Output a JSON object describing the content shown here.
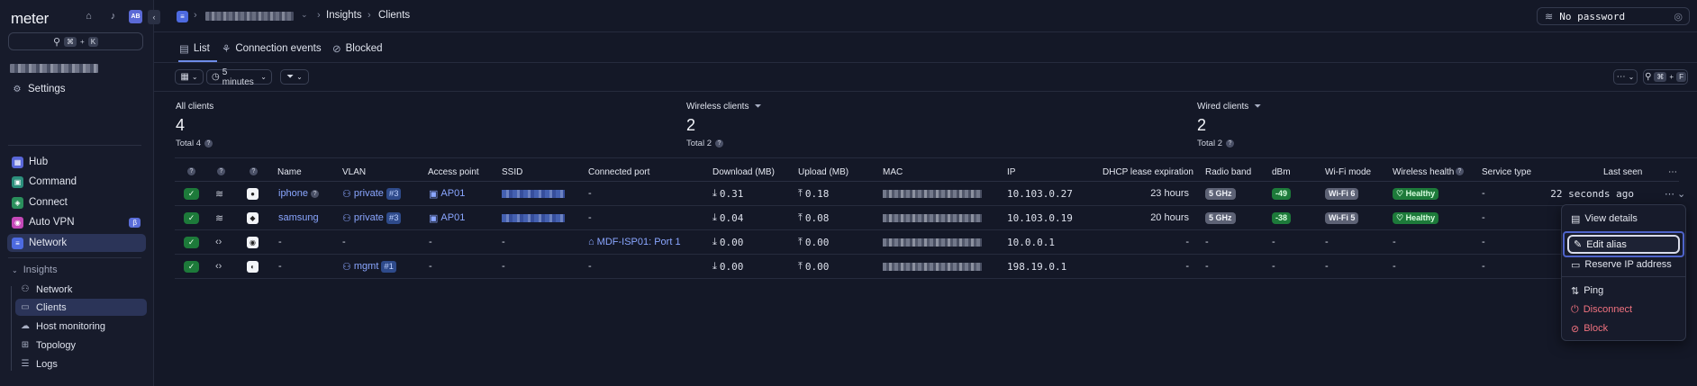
{
  "sidebar": {
    "logo": "meter",
    "avatar_initials": "AB",
    "search_shortcut": [
      "⌘",
      "K"
    ],
    "settings_label": "Settings",
    "items": [
      {
        "label": "Hub",
        "color": "#5967d8"
      },
      {
        "label": "Command",
        "color": "#2c8f7c"
      },
      {
        "label": "Connect",
        "color": "#2a8f5c"
      },
      {
        "label": "Auto VPN",
        "color": "#c448b8",
        "badge": "β"
      },
      {
        "label": "Network",
        "color": "#4d6ae0"
      }
    ],
    "insights_label": "Insights",
    "sub_items": [
      {
        "label": "Network"
      },
      {
        "label": "Clients"
      },
      {
        "label": "Host monitoring"
      },
      {
        "label": "Topology"
      },
      {
        "label": "Logs"
      }
    ]
  },
  "header": {
    "breadcrumbs": [
      "Insights",
      "Clients"
    ],
    "password_label": "No password"
  },
  "tabs": [
    {
      "label": "List"
    },
    {
      "label": "Connection events"
    },
    {
      "label": "Blocked"
    }
  ],
  "toolbar": {
    "time_range": "5 minutes",
    "search_shortcut": [
      "⌘",
      "F"
    ]
  },
  "stats": [
    {
      "label": "All clients",
      "value": "4",
      "total": "Total 4"
    },
    {
      "label": "Wireless clients",
      "value": "2",
      "total": "Total 2"
    },
    {
      "label": "Wired clients",
      "value": "2",
      "total": "Total 2"
    }
  ],
  "table": {
    "columns": [
      "Name",
      "VLAN",
      "Access point",
      "SSID",
      "Connected port",
      "Download (MB)",
      "Upload (MB)",
      "MAC",
      "IP",
      "DHCP lease expiration",
      "Radio band",
      "dBm",
      "Wi-Fi mode",
      "Wireless health",
      "Service type",
      "Last seen"
    ],
    "rows": [
      {
        "name": "iphone",
        "vlan": "private",
        "vlan_num": "#3",
        "ap": "AP01",
        "port": "-",
        "download": "0.31",
        "upload": "0.18",
        "ip": "10.103.0.27",
        "lease": "23 hours",
        "band": "5 GHz",
        "dbm": "-49",
        "wifi_mode": "Wi-Fi 6",
        "health": "Healthy",
        "service": "-",
        "last_seen": "22 seconds ago"
      },
      {
        "name": "samsung",
        "vlan": "private",
        "vlan_num": "#3",
        "ap": "AP01",
        "port": "-",
        "download": "0.04",
        "upload": "0.08",
        "ip": "10.103.0.19",
        "lease": "20 hours",
        "band": "5 GHz",
        "dbm": "-38",
        "wifi_mode": "Wi-Fi 5",
        "health": "Healthy",
        "service": "-",
        "last_seen": ""
      },
      {
        "name": "-",
        "vlan": "-",
        "vlan_num": "",
        "ap": "-",
        "ssid": "-",
        "port": "MDF-ISP01: Port 1",
        "download": "0.00",
        "upload": "0.00",
        "ip": "10.0.0.1",
        "lease": "-",
        "band": "-",
        "dbm": "-",
        "wifi_mode": "-",
        "health": "-",
        "service": "-",
        "last_seen": ""
      },
      {
        "name": "-",
        "vlan": "mgmt",
        "vlan_num": "#1",
        "ap": "-",
        "ssid": "-",
        "port": "-",
        "download": "0.00",
        "upload": "0.00",
        "ip": "198.19.0.1",
        "lease": "-",
        "band": "-",
        "dbm": "-",
        "wifi_mode": "-",
        "health": "-",
        "service": "-",
        "last_seen": ""
      }
    ]
  },
  "menu": {
    "items": [
      "View details",
      "Edit alias",
      "Reserve IP address",
      "Ping",
      "Disconnect",
      "Block"
    ]
  }
}
